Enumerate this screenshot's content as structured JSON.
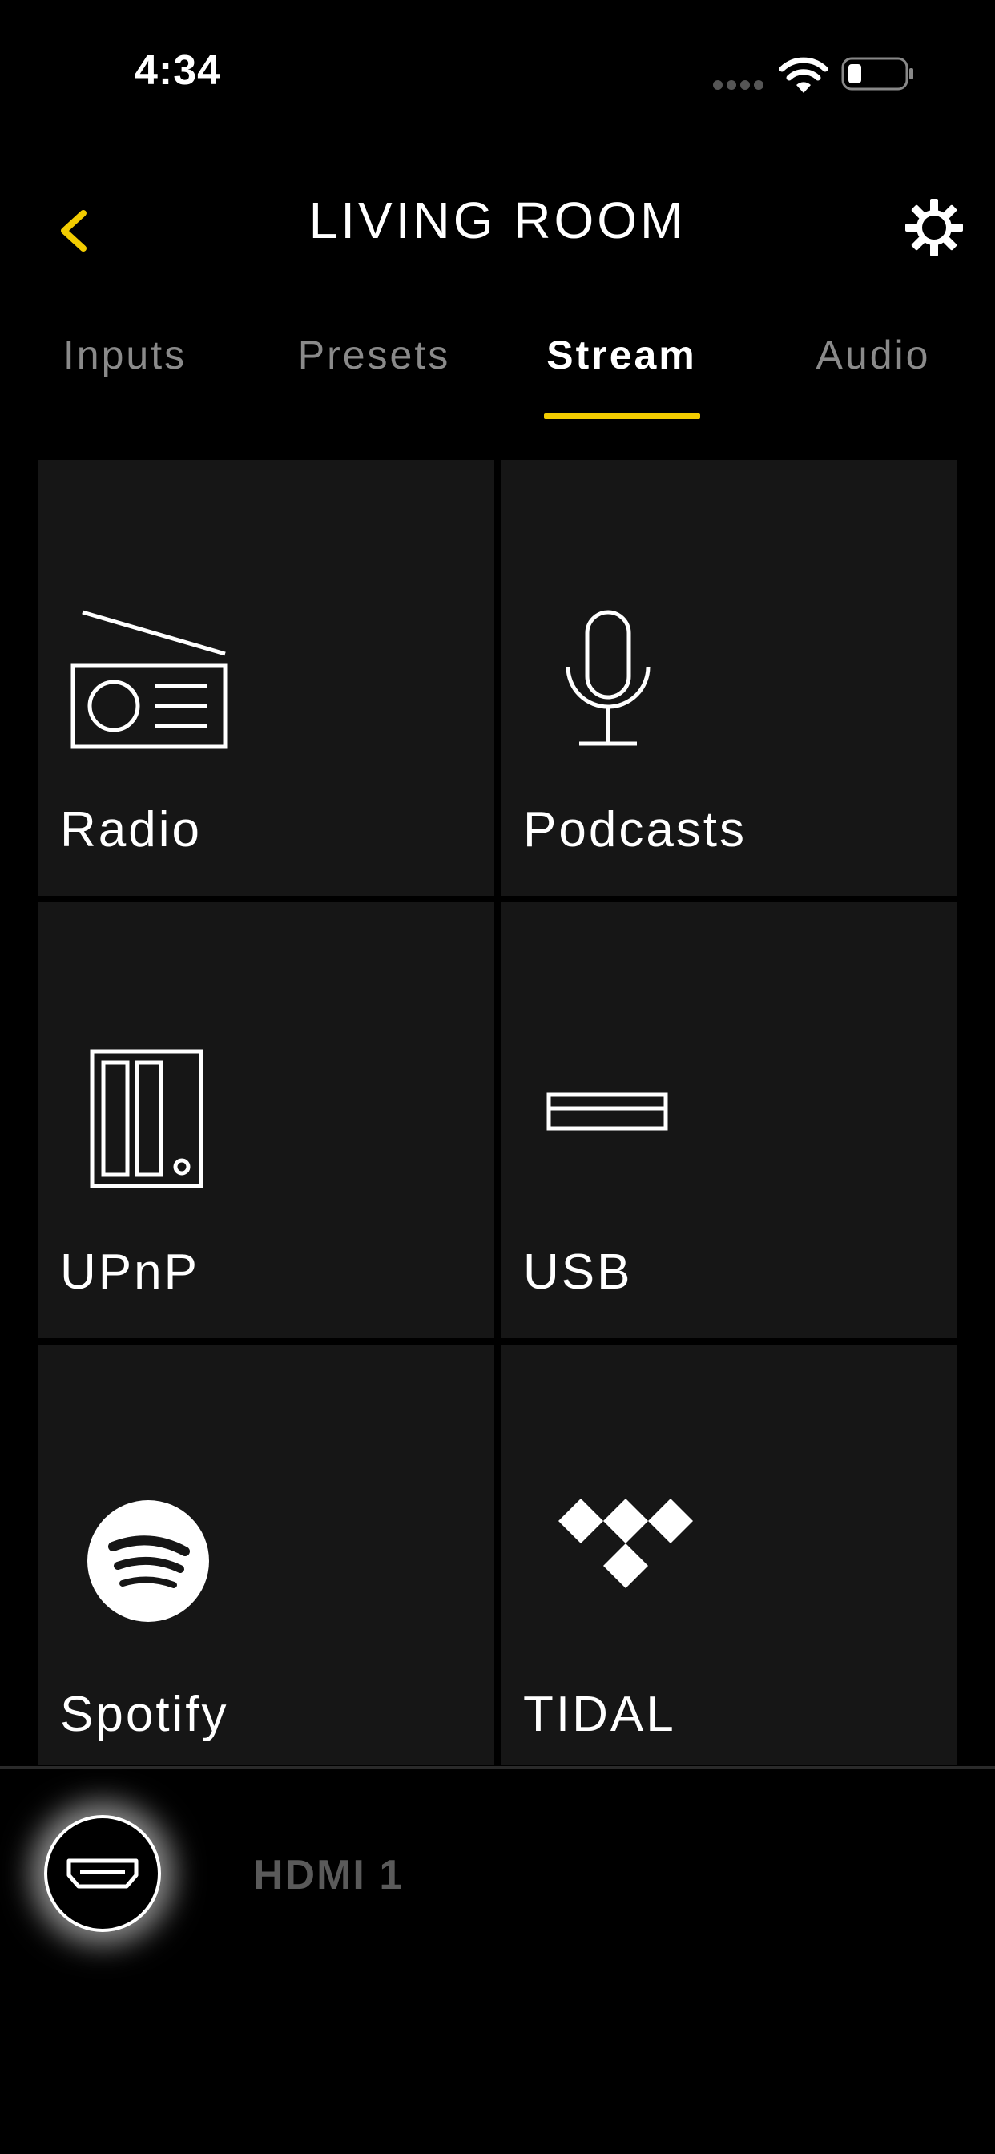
{
  "status_bar": {
    "time": "4:34"
  },
  "header": {
    "title": "LIVING ROOM",
    "back_icon": "chevron-left-icon",
    "settings_icon": "gear-icon",
    "accent_color": "#f2cc00"
  },
  "tabs": [
    {
      "label": "Inputs",
      "active": false
    },
    {
      "label": "Presets",
      "active": false
    },
    {
      "label": "Stream",
      "active": true
    },
    {
      "label": "Audio",
      "active": false
    }
  ],
  "tiles": [
    {
      "label": "Radio",
      "icon": "radio-icon"
    },
    {
      "label": "Podcasts",
      "icon": "microphone-icon"
    },
    {
      "label": "UPnP",
      "icon": "nas-drive-icon"
    },
    {
      "label": "USB",
      "icon": "usb-icon"
    },
    {
      "label": "Spotify",
      "icon": "spotify-icon"
    },
    {
      "label": "TIDAL",
      "icon": "tidal-icon"
    }
  ],
  "now_playing": {
    "source_icon": "hdmi-icon",
    "source_label": "HDMI 1"
  }
}
